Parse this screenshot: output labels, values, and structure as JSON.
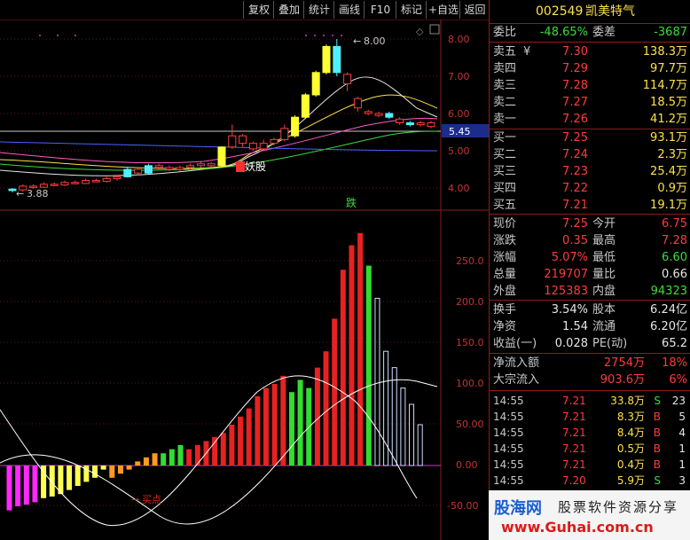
{
  "toolbar": {
    "buttons": [
      "复权",
      "叠加",
      "统计",
      "画线",
      "F10",
      "标记",
      "+自选",
      "返回"
    ]
  },
  "chart": {
    "price_ticks": [
      "8.00",
      "7.00",
      "6.00",
      "5.00",
      "4.00"
    ],
    "current_price": "5.45",
    "high_label": "8.00",
    "low_label": "3.88",
    "annotation_yaogu": "妖股",
    "annotation_die": "跌",
    "annotation_buy": "买点",
    "indicator_ticks": [
      "250.0",
      "200.0",
      "150.0",
      "100.0",
      "50.00",
      "0.00",
      "-50.00"
    ]
  },
  "chart_data": {
    "type": "bar",
    "candles": [
      {
        "o": 3.97,
        "c": 3.93,
        "h": 4.0,
        "l": 3.88,
        "color": "cyan"
      },
      {
        "o": 3.95,
        "c": 4.05,
        "h": 4.1,
        "l": 3.9,
        "color": "red"
      },
      {
        "o": 4.05,
        "c": 4.02,
        "h": 4.1,
        "l": 3.98,
        "color": "red"
      },
      {
        "o": 4.02,
        "c": 4.1,
        "h": 4.15,
        "l": 4.0,
        "color": "red"
      },
      {
        "o": 4.1,
        "c": 4.08,
        "h": 4.15,
        "l": 4.05,
        "color": "red"
      },
      {
        "o": 4.08,
        "c": 4.15,
        "h": 4.2,
        "l": 4.05,
        "color": "red"
      },
      {
        "o": 4.15,
        "c": 4.12,
        "h": 4.2,
        "l": 4.1,
        "color": "red"
      },
      {
        "o": 4.12,
        "c": 4.2,
        "h": 4.25,
        "l": 4.1,
        "color": "red"
      },
      {
        "o": 4.2,
        "c": 4.18,
        "h": 4.25,
        "l": 4.15,
        "color": "red"
      },
      {
        "o": 4.18,
        "c": 4.25,
        "h": 4.3,
        "l": 4.15,
        "color": "red"
      },
      {
        "o": 4.25,
        "c": 4.3,
        "h": 4.35,
        "l": 4.2,
        "color": "red"
      },
      {
        "o": 4.3,
        "c": 4.5,
        "h": 4.55,
        "l": 4.28,
        "color": "cyan"
      },
      {
        "o": 4.5,
        "c": 4.4,
        "h": 4.55,
        "l": 4.35,
        "color": "red"
      },
      {
        "o": 4.4,
        "c": 4.6,
        "h": 4.65,
        "l": 4.38,
        "color": "cyan"
      },
      {
        "o": 4.6,
        "c": 4.55,
        "h": 4.65,
        "l": 4.5,
        "color": "red"
      },
      {
        "o": 4.55,
        "c": 4.5,
        "h": 4.6,
        "l": 4.45,
        "color": "red"
      },
      {
        "o": 4.5,
        "c": 4.55,
        "h": 4.6,
        "l": 4.45,
        "color": "red"
      },
      {
        "o": 4.55,
        "c": 4.6,
        "h": 4.65,
        "l": 4.5,
        "color": "red"
      },
      {
        "o": 4.6,
        "c": 4.65,
        "h": 4.7,
        "l": 4.55,
        "color": "red"
      },
      {
        "o": 4.65,
        "c": 4.6,
        "h": 4.7,
        "l": 4.55,
        "color": "red"
      },
      {
        "o": 4.6,
        "c": 5.1,
        "h": 5.12,
        "l": 4.55,
        "color": "yellow"
      },
      {
        "o": 5.1,
        "c": 5.4,
        "h": 5.7,
        "l": 5.05,
        "color": "red"
      },
      {
        "o": 5.4,
        "c": 5.2,
        "h": 5.45,
        "l": 5.1,
        "color": "red"
      },
      {
        "o": 5.2,
        "c": 5.05,
        "h": 5.25,
        "l": 5.0,
        "color": "red"
      },
      {
        "o": 5.05,
        "c": 5.2,
        "h": 5.3,
        "l": 5.0,
        "color": "red"
      },
      {
        "o": 5.2,
        "c": 5.3,
        "h": 5.35,
        "l": 5.15,
        "color": "red"
      },
      {
        "o": 5.3,
        "c": 5.6,
        "h": 5.7,
        "l": 5.25,
        "color": "red"
      },
      {
        "o": 5.4,
        "c": 5.9,
        "h": 5.95,
        "l": 5.35,
        "color": "yellow"
      },
      {
        "o": 5.9,
        "c": 6.5,
        "h": 6.55,
        "l": 5.85,
        "color": "yellow"
      },
      {
        "o": 6.5,
        "c": 7.1,
        "h": 7.15,
        "l": 6.45,
        "color": "yellow"
      },
      {
        "o": 7.1,
        "c": 7.8,
        "h": 7.85,
        "l": 7.05,
        "color": "yellow"
      },
      {
        "o": 7.8,
        "c": 7.1,
        "h": 8.0,
        "l": 7.0,
        "color": "cyan"
      },
      {
        "o": 6.8,
        "c": 7.05,
        "h": 7.1,
        "l": 6.6,
        "color": "red"
      },
      {
        "o": 6.4,
        "c": 6.15,
        "h": 6.45,
        "l": 6.05,
        "color": "red"
      },
      {
        "o": 6.05,
        "c": 6.0,
        "h": 6.1,
        "l": 5.95,
        "color": "red"
      },
      {
        "o": 5.95,
        "c": 6.0,
        "h": 6.05,
        "l": 5.9,
        "color": "red"
      },
      {
        "o": 6.0,
        "c": 5.9,
        "h": 6.05,
        "l": 5.85,
        "color": "cyan"
      },
      {
        "o": 5.85,
        "c": 5.75,
        "h": 5.9,
        "l": 5.7,
        "color": "red"
      },
      {
        "o": 5.75,
        "c": 5.7,
        "h": 5.8,
        "l": 5.65,
        "color": "cyan"
      },
      {
        "o": 5.7,
        "c": 5.75,
        "h": 5.8,
        "l": 5.65,
        "color": "red"
      },
      {
        "o": 5.75,
        "c": 5.65,
        "h": 5.8,
        "l": 5.6,
        "color": "red"
      }
    ],
    "indicator_bars": [
      {
        "v": -55,
        "color": "#ff28ff"
      },
      {
        "v": -50,
        "color": "#ff28ff"
      },
      {
        "v": -48,
        "color": "#ff28ff"
      },
      {
        "v": -45,
        "color": "#ff28ff"
      },
      {
        "v": -40,
        "color": "#ffff50"
      },
      {
        "v": -38,
        "color": "#ffff50"
      },
      {
        "v": -35,
        "color": "#ffff50"
      },
      {
        "v": -30,
        "color": "#ffff50"
      },
      {
        "v": -25,
        "color": "#ffff50"
      },
      {
        "v": -20,
        "color": "#ffff50"
      },
      {
        "v": -15,
        "color": "#ffff50"
      },
      {
        "v": -5,
        "color": "#ffff50"
      },
      {
        "v": -15,
        "color": "#ff9c1c"
      },
      {
        "v": -10,
        "color": "#ff9c1c"
      },
      {
        "v": -5,
        "color": "#ff9c1c"
      },
      {
        "v": 5,
        "color": "#ff9c1c"
      },
      {
        "v": 10,
        "color": "#ff9c1c"
      },
      {
        "v": 15,
        "color": "#ff9c1c"
      },
      {
        "v": 15,
        "color": "#32dc32"
      },
      {
        "v": 20,
        "color": "#32dc32"
      },
      {
        "v": 25,
        "color": "#32dc32"
      },
      {
        "v": 20,
        "color": "#e62222"
      },
      {
        "v": 25,
        "color": "#e62222"
      },
      {
        "v": 30,
        "color": "#e62222"
      },
      {
        "v": 35,
        "color": "#e62222"
      },
      {
        "v": 40,
        "color": "#e62222"
      },
      {
        "v": 50,
        "color": "#e62222"
      },
      {
        "v": 60,
        "color": "#e62222"
      },
      {
        "v": 70,
        "color": "#e62222"
      },
      {
        "v": 85,
        "color": "#e62222"
      },
      {
        "v": 95,
        "color": "#e62222"
      },
      {
        "v": 100,
        "color": "#e62222"
      },
      {
        "v": 110,
        "color": "#e62222"
      },
      {
        "v": 90,
        "color": "#32dc32"
      },
      {
        "v": 105,
        "color": "#32dc32"
      },
      {
        "v": 95,
        "color": "#32dc32"
      },
      {
        "v": 120,
        "color": "#e62222"
      },
      {
        "v": 140,
        "color": "#e62222"
      },
      {
        "v": 180,
        "color": "#e62222"
      },
      {
        "v": 240,
        "color": "#e62222"
      },
      {
        "v": 270,
        "color": "#e62222"
      },
      {
        "v": 285,
        "color": "#e62222"
      },
      {
        "v": 245,
        "color": "#32dc32"
      },
      {
        "v": 205,
        "color": "#ccddff",
        "hollow": true
      },
      {
        "v": 140,
        "color": "#ccddff",
        "hollow": true
      },
      {
        "v": 120,
        "color": "#ccddff",
        "hollow": true
      },
      {
        "v": 95,
        "color": "#ccddff",
        "hollow": true
      },
      {
        "v": 75,
        "color": "#ccddff",
        "hollow": true
      },
      {
        "v": 50,
        "color": "#ccddff",
        "hollow": true
      }
    ],
    "ylim_price": [
      3.5,
      8.3
    ],
    "ylim_indicator": [
      -90,
      300
    ]
  },
  "quote": {
    "code": "002549",
    "name": "凯美特气",
    "weibi_label": "委比",
    "weibi_value": "-48.65%",
    "weicha_label": "委差",
    "weicha_value": "-3687",
    "sell": [
      {
        "label": "卖五",
        "price": "7.30",
        "vol": "138.3万"
      },
      {
        "label": "卖四",
        "price": "7.29",
        "vol": "97.7万"
      },
      {
        "label": "卖三",
        "price": "7.28",
        "vol": "114.7万"
      },
      {
        "label": "卖二",
        "price": "7.27",
        "vol": "18.5万"
      },
      {
        "label": "卖一",
        "price": "7.26",
        "vol": "41.2万"
      }
    ],
    "buy": [
      {
        "label": "买一",
        "price": "7.25",
        "vol": "93.1万"
      },
      {
        "label": "买二",
        "price": "7.24",
        "vol": "2.3万"
      },
      {
        "label": "买三",
        "price": "7.23",
        "vol": "25.4万"
      },
      {
        "label": "买四",
        "price": "7.22",
        "vol": "0.9万"
      },
      {
        "label": "买五",
        "price": "7.21",
        "vol": "19.1万"
      }
    ],
    "yen_symbol": "¥",
    "stats1": [
      {
        "l1": "现价",
        "v1": "7.25",
        "l2": "今开",
        "v2": "6.75"
      },
      {
        "l1": "涨跌",
        "v1": "0.35",
        "l2": "最高",
        "v2": "7.28"
      },
      {
        "l1": "涨幅",
        "v1": "5.07%",
        "l2": "最低",
        "v2": "6.60"
      },
      {
        "l1": "总量",
        "v1": "219707",
        "l2": "量比",
        "v2": "0.66"
      },
      {
        "l1": "外盘",
        "v1": "125383",
        "l2": "内盘",
        "v2": "94323"
      }
    ],
    "stats2": [
      {
        "l1": "换手",
        "v1": "3.54%",
        "l2": "股本",
        "v2": "6.24亿"
      },
      {
        "l1": "净资",
        "v1": "1.54",
        "l2": "流通",
        "v2": "6.20亿"
      },
      {
        "l1": "收益(一)",
        "v1": "0.028",
        "l2": "PE(动)",
        "v2": "65.2"
      }
    ],
    "flow": [
      {
        "label": "净流入额",
        "value": "2754万",
        "pct": "18%"
      },
      {
        "label": "大宗流入",
        "value": "903.6万",
        "pct": "6%"
      }
    ],
    "ticks": [
      {
        "time": "14:55",
        "price": "7.21",
        "vol": "33.8万",
        "side": "S",
        "count": "23"
      },
      {
        "time": "14:55",
        "price": "7.21",
        "vol": "8.3万",
        "side": "B",
        "count": "5"
      },
      {
        "time": "14:55",
        "price": "7.21",
        "vol": "8.4万",
        "side": "B",
        "count": "4"
      },
      {
        "time": "14:55",
        "price": "7.21",
        "vol": "0.5万",
        "side": "B",
        "count": "1"
      },
      {
        "time": "14:55",
        "price": "7.21",
        "vol": "0.4万",
        "side": "B",
        "count": "1"
      },
      {
        "time": "14:55",
        "price": "7.20",
        "vol": "5.9万",
        "side": "S",
        "count": "3"
      }
    ]
  },
  "banner": {
    "site_name": "股海网",
    "slogan": "股票软件资源分享",
    "url": "www.Guhai.com.cn"
  }
}
